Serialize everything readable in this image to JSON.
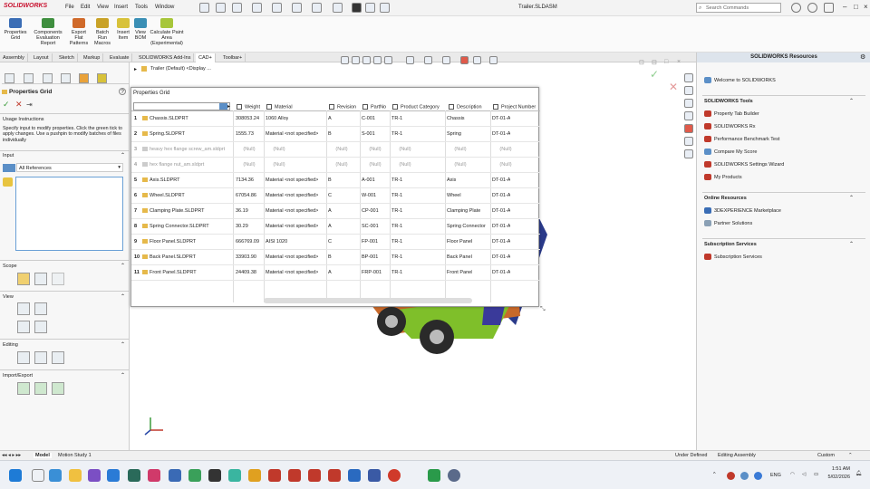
{
  "window": {
    "app_name": "SOLIDWORKS",
    "menus": [
      "File",
      "Edit",
      "View",
      "Insert",
      "Tools",
      "Window"
    ],
    "doc_title": "Trailer.SLDASM",
    "search_placeholder": "Search Commands"
  },
  "ribbon": {
    "buttons": [
      {
        "label": "Properties Grid",
        "icon": "grid-icon",
        "color": "#3a6db5"
      },
      {
        "label": "Components Evaluation Report",
        "icon": "report-icon",
        "color": "#3f8f3f"
      },
      {
        "label": "Export Flat Patterns",
        "icon": "export-icon",
        "color": "#d06a2a"
      },
      {
        "label": "Batch Run Macros",
        "icon": "macro-icon",
        "color": "#c9a227"
      },
      {
        "label": "Insert Item",
        "icon": "insert-icon",
        "color": "#d8c23a"
      },
      {
        "label": "View BOM",
        "icon": "bom-icon",
        "color": "#3a8fb5"
      },
      {
        "label": "Calculate Paint Area (Experimental)",
        "icon": "paint-icon",
        "color": "#a7c63a"
      }
    ]
  },
  "tabs": [
    "Assembly",
    "Layout",
    "Sketch",
    "Markup",
    "Evaluate",
    "SOLIDWORKS Add-Ins",
    "CAD+",
    "Toolbar+"
  ],
  "active_tab": "CAD+",
  "left_panel": {
    "title": "Properties Grid",
    "help": "?",
    "usage_heading": "Usage Instructions",
    "usage_text": "Specify input to modify properties. Click the green tick to apply changes. Use a pushpin to modify batches of files individually",
    "input_heading": "Input",
    "input_value": "All References",
    "scope_heading": "Scope",
    "view_heading": "View",
    "editing_heading": "Editing",
    "import_export_heading": "Import/Export"
  },
  "tree": {
    "root": "Trailer (Default) <Display ..."
  },
  "grid": {
    "title": "Properties Grid",
    "columns": [
      "Weight",
      "Material",
      "Revision",
      "PartNo",
      "Product Category",
      "Description",
      "Project Number"
    ],
    "rows": [
      {
        "n": "1",
        "name": "Chassis.SLDPRT",
        "weight": "308053.24",
        "material": "1060 Alloy",
        "revision": "A",
        "partno": "C-001",
        "category": "TR-1",
        "description": "Chassis",
        "project": "DT-01-A"
      },
      {
        "n": "2",
        "name": "Spring.SLDPRT",
        "weight": "1555.73",
        "material": "Material <not specified>",
        "revision": "B",
        "partno": "S-001",
        "category": "TR-1",
        "description": "Spring",
        "project": "DT-01-A"
      },
      {
        "n": "3",
        "name": "heavy hex flange screw_am.sldprt",
        "weight": "(Null)",
        "material": "(Null)",
        "revision": "(Null)",
        "partno": "(Null)",
        "category": "(Null)",
        "description": "(Null)",
        "project": "(Null)",
        "faded": true
      },
      {
        "n": "4",
        "name": "hex flange nut_am.sldprt",
        "weight": "(Null)",
        "material": "(Null)",
        "revision": "(Null)",
        "partno": "(Null)",
        "category": "(Null)",
        "description": "(Null)",
        "project": "(Null)",
        "faded": true
      },
      {
        "n": "5",
        "name": "Axis.SLDPRT",
        "weight": "7134.36",
        "material": "Material <not specified>",
        "revision": "B",
        "partno": "A-001",
        "category": "TR-1",
        "description": "Axis",
        "project": "DT-01-A"
      },
      {
        "n": "6",
        "name": "Wheel.SLDPRT",
        "weight": "67054.86",
        "material": "Material <not specified>",
        "revision": "C",
        "partno": "W-001",
        "category": "TR-1",
        "description": "Wheel",
        "project": "DT-01-A"
      },
      {
        "n": "7",
        "name": "Clamping Plate.SLDPRT",
        "weight": "36.19",
        "material": "Material <not specified>",
        "revision": "A",
        "partno": "CP-001",
        "category": "TR-1",
        "description": "Clamping Plate",
        "project": "DT-01-A"
      },
      {
        "n": "8",
        "name": "Spring Connector.SLDPRT",
        "weight": "30.29",
        "material": "Material <not specified>",
        "revision": "A",
        "partno": "SC-001",
        "category": "TR-1",
        "description": "Spring Connector",
        "project": "DT-01-A"
      },
      {
        "n": "9",
        "name": "Floor Panel.SLDPRT",
        "weight": "666769.09",
        "material": "AISI 1020",
        "revision": "C",
        "partno": "FP-001",
        "category": "TR-1",
        "description": "Floor Panel",
        "project": "DT-01-A"
      },
      {
        "n": "10",
        "name": "Back Panel.SLDPRT",
        "weight": "33903.90",
        "material": "Material <not specified>",
        "revision": "B",
        "partno": "BP-001",
        "category": "TR-1",
        "description": "Back Panel",
        "project": "DT-01-A"
      },
      {
        "n": "11",
        "name": "Front Panel.SLDPRT",
        "weight": "24409.38",
        "material": "Material <not specified>",
        "revision": "A",
        "partno": "FRP-001",
        "category": "TR-1",
        "description": "Front Panel",
        "project": "DT-01-A"
      }
    ]
  },
  "right_panel": {
    "title": "SOLIDWORKS Resources",
    "welcome": "Welcome to SOLIDWORKS",
    "tools_heading": "SOLIDWORKS Tools",
    "tools": [
      "Property Tab Builder",
      "SOLIDWORKS Rx",
      "Performance Benchmark Test",
      "Compare My Score",
      "SOLIDWORKS Settings Wizard",
      "My Products"
    ],
    "online_heading": "Online Resources",
    "online": [
      "3DEXPERIENCE Marketplace",
      "Partner Solutions"
    ],
    "subscription_heading": "Subscription Services",
    "subscription": [
      "Subscription Services"
    ]
  },
  "bottom_tabs": [
    "Model",
    "Motion Study 1"
  ],
  "status": {
    "state": "Under Defined",
    "mode": "Editing Assembly",
    "units": "Custom"
  },
  "taskbar": {
    "lang": "ENG",
    "time": "1:51 AM",
    "date": "5/02/2026"
  }
}
